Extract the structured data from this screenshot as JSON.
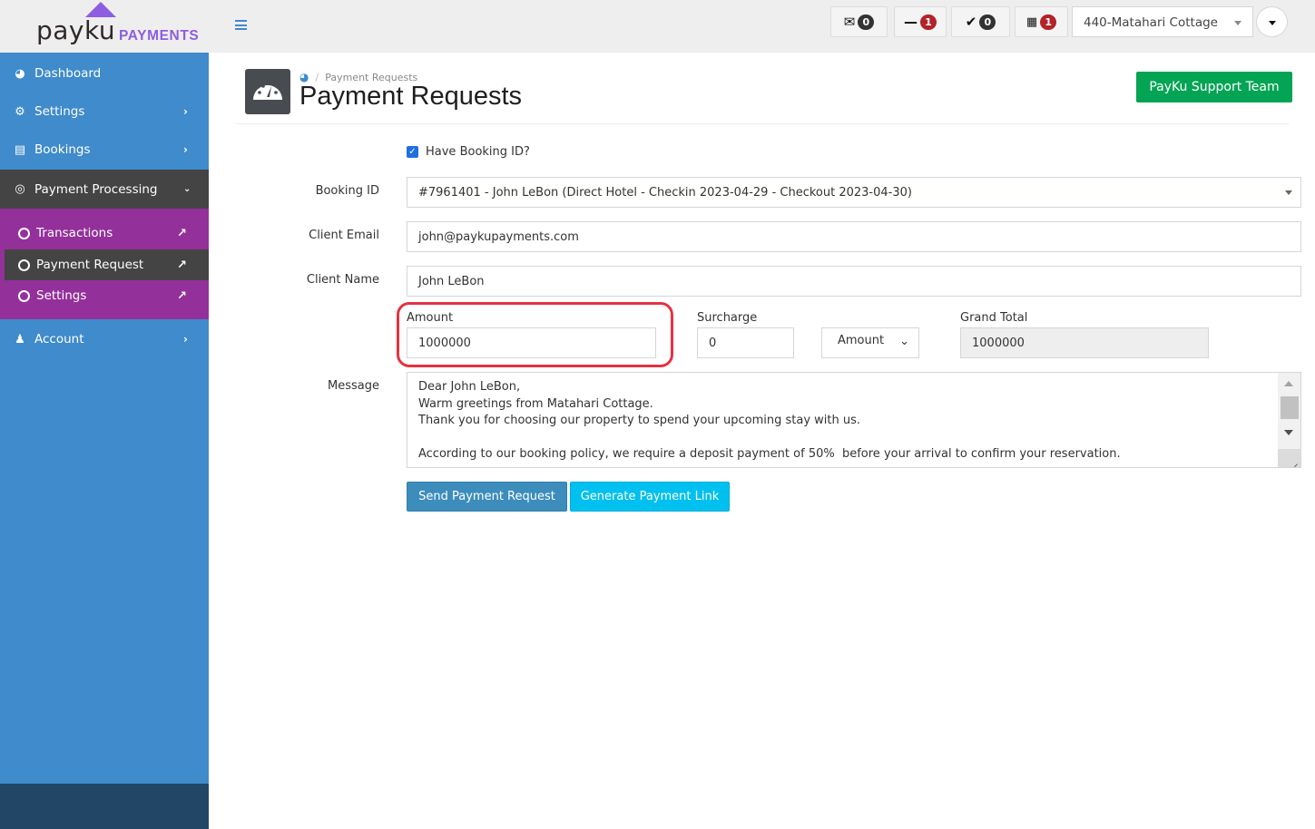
{
  "brand": {
    "name": "payku",
    "suffix": "PAYMENTS",
    "accent": "#8e5ee0"
  },
  "topbar": {
    "menu_icon": "hamburger-icon",
    "indicators": [
      {
        "icon": "envelope-open-icon",
        "count": "0",
        "color": "#333333"
      },
      {
        "icon": "minus-icon",
        "count": "1",
        "color": "#b3232a"
      },
      {
        "icon": "check-icon",
        "count": "0",
        "color": "#333333"
      },
      {
        "icon": "calendar-icon",
        "count": "1",
        "color": "#b3232a"
      }
    ],
    "property_select": "440-Matahari Cottage"
  },
  "sidebar": {
    "items": [
      {
        "label": "Dashboard",
        "icon": "dashboard-icon"
      },
      {
        "label": "Settings",
        "icon": "gear-icon"
      },
      {
        "label": "Bookings",
        "icon": "id-card-icon"
      },
      {
        "label": "Payment Processing",
        "icon": "target-icon"
      },
      {
        "label": "Account",
        "icon": "user-icon"
      }
    ],
    "submenu": [
      {
        "label": "Transactions"
      },
      {
        "label": "Payment Request",
        "active": true
      },
      {
        "label": "Settings"
      }
    ],
    "colors": {
      "main": "#3f8bcb",
      "submenu": "#93309a",
      "active": "#444444",
      "footer": "#224666"
    }
  },
  "header": {
    "breadcrumb": "Payment Requests",
    "title": "Payment Requests",
    "support_button": "PayKu Support Team"
  },
  "form": {
    "have_booking_id": {
      "label": "Have Booking ID?",
      "checked": true
    },
    "booking_id": {
      "label": "Booking ID",
      "value": "#7961401 - John LeBon (Direct Hotel - Checkin 2023-04-29 - Checkout 2023-04-30)"
    },
    "client_email": {
      "label": "Client Email",
      "value": "john@paykupayments.com"
    },
    "client_name": {
      "label": "Client Name",
      "value": "John LeBon"
    },
    "amount": {
      "label": "Amount",
      "value": "1000000"
    },
    "surcharge": {
      "label": "Surcharge",
      "value": "0"
    },
    "surcharge_type": {
      "value": "Amount"
    },
    "grand_total": {
      "label": "Grand Total",
      "value": "1000000"
    },
    "message": {
      "label": "Message",
      "lines": [
        "Dear John LeBon,",
        "Warm greetings from Matahari Cottage.",
        "Thank you for choosing our property to spend your upcoming stay with us.",
        "",
        "According to our booking policy, we require a deposit payment of 50%  before your arrival to confirm your reservation."
      ]
    },
    "send_button": "Send Payment Request",
    "generate_button": "Generate Payment Link"
  },
  "annotation": {
    "highlight_color": "#e53242",
    "target": "amount"
  }
}
